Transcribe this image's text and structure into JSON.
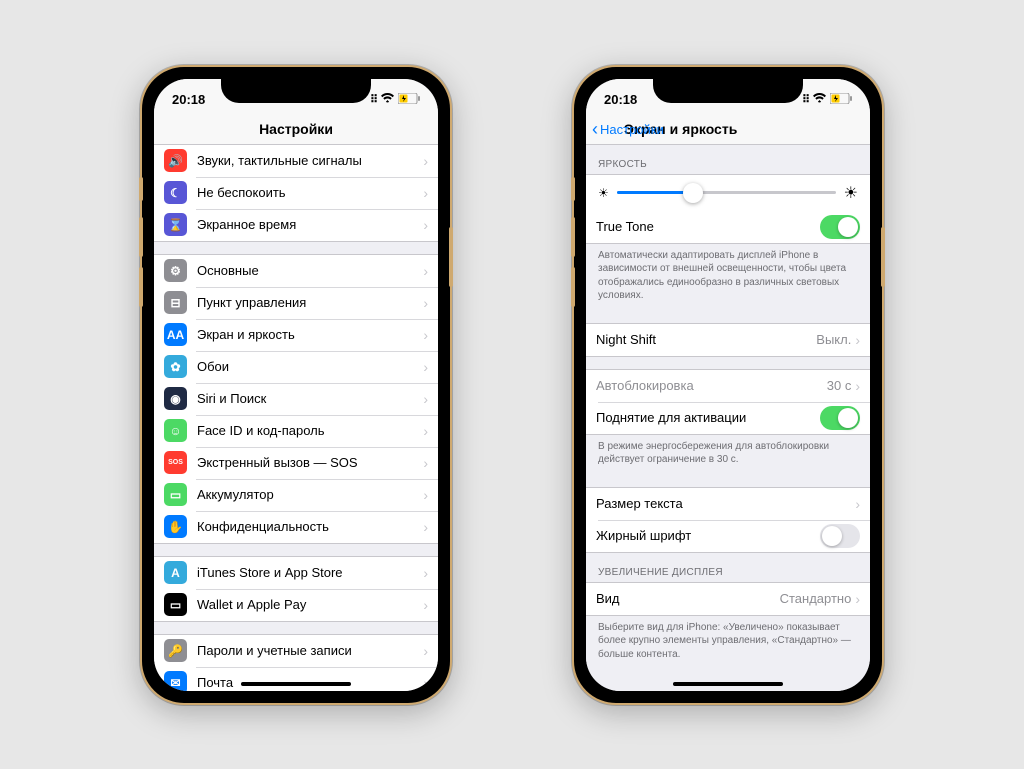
{
  "statusbar": {
    "time": "20:18"
  },
  "left_phone": {
    "title": "Настройки",
    "groups": [
      {
        "top": true,
        "items": [
          {
            "icon_bg": "#ff3b30",
            "icon_glyph": "🔊",
            "label": "Звуки, тактильные сигналы"
          },
          {
            "icon_bg": "#5856d6",
            "icon_glyph": "☾",
            "label": "Не беспокоить"
          },
          {
            "icon_bg": "#5856d6",
            "icon_glyph": "⌛",
            "label": "Экранное время"
          }
        ]
      },
      {
        "items": [
          {
            "icon_bg": "#8e8e93",
            "icon_glyph": "⚙",
            "label": "Основные"
          },
          {
            "icon_bg": "#8e8e93",
            "icon_glyph": "⊟",
            "label": "Пункт управления"
          },
          {
            "icon_bg": "#007aff",
            "icon_glyph": "AA",
            "label": "Экран и яркость"
          },
          {
            "icon_bg": "#34aadc",
            "icon_glyph": "✿",
            "label": "Обои"
          },
          {
            "icon_bg": "#1f2a44",
            "icon_glyph": "◉",
            "label": "Siri и Поиск"
          },
          {
            "icon_bg": "#4cd964",
            "icon_glyph": "☺",
            "label": "Face ID и код-пароль"
          },
          {
            "icon_bg": "#ff3b30",
            "icon_glyph": "SOS",
            "label": "Экстренный вызов — SOS"
          },
          {
            "icon_bg": "#4cd964",
            "icon_glyph": "▭",
            "label": "Аккумулятор"
          },
          {
            "icon_bg": "#007aff",
            "icon_glyph": "✋",
            "label": "Конфиденциальность"
          }
        ]
      },
      {
        "items": [
          {
            "icon_bg": "#34aadc",
            "icon_glyph": "A",
            "label": "iTunes Store и App Store"
          },
          {
            "icon_bg": "#000000",
            "icon_glyph": "▭",
            "label": "Wallet и Apple Pay"
          }
        ]
      },
      {
        "items": [
          {
            "icon_bg": "#8e8e93",
            "icon_glyph": "🔑",
            "label": "Пароли и учетные записи"
          },
          {
            "icon_bg": "#007aff",
            "icon_glyph": "✉",
            "label": "Почта"
          }
        ]
      }
    ]
  },
  "right_phone": {
    "back_label": "Настройки",
    "title": "Экран и яркость",
    "brightness_header": "ЯРКОСТЬ",
    "true_tone_label": "True Tone",
    "true_tone_on": true,
    "true_tone_footer": "Автоматически адаптировать дисплей iPhone в зависимости от внешней освещенности, чтобы цвета отображались единообразно в различных световых условиях.",
    "night_shift_label": "Night Shift",
    "night_shift_value": "Выкл.",
    "autolock_label": "Автоблокировка",
    "autolock_value": "30 c",
    "raise_label": "Поднятие для активации",
    "raise_on": true,
    "autolock_footer": "В режиме энергосбережения для автоблокировки действует ограничение в 30 с.",
    "text_size_label": "Размер текста",
    "bold_label": "Жирный шрифт",
    "bold_on": false,
    "zoom_header": "УВЕЛИЧЕНИЕ ДИСПЛЕЯ",
    "view_label": "Вид",
    "view_value": "Стандартно",
    "view_footer": "Выберите вид для iPhone: «Увеличено» показывает более крупно элементы управления, «Стандартно» — больше контента."
  }
}
